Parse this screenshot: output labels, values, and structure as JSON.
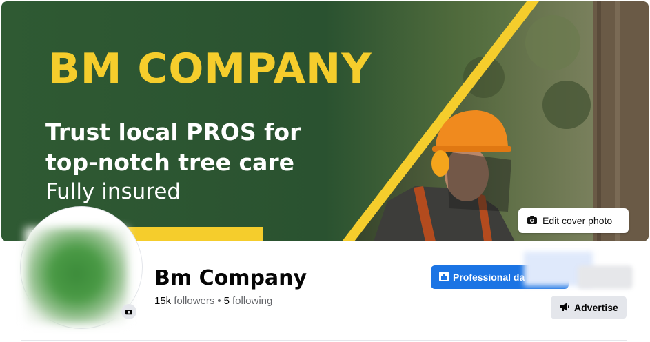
{
  "cover": {
    "headline": "BM COMPANY",
    "tagline_line1": "Trust local PROS for",
    "tagline_line2": "top-notch tree care",
    "insured": "Fully insured",
    "edit_label": "Edit cover photo"
  },
  "profile": {
    "name": "Bm Company",
    "followers": "15k",
    "followers_label": "followers",
    "separator": "•",
    "following": "5",
    "following_label": "following"
  },
  "actions": {
    "professional_label": "Professional da",
    "advertise_label": "Advertise"
  },
  "colors": {
    "brand_green": "#2f5a33",
    "brand_yellow": "#f5cd2c",
    "primary_blue": "#1b74e4"
  },
  "icons": {
    "edit_cover": "camera-icon",
    "avatar_edit": "camera-icon",
    "professional": "bar-chart-icon",
    "advertise": "megaphone-icon"
  }
}
